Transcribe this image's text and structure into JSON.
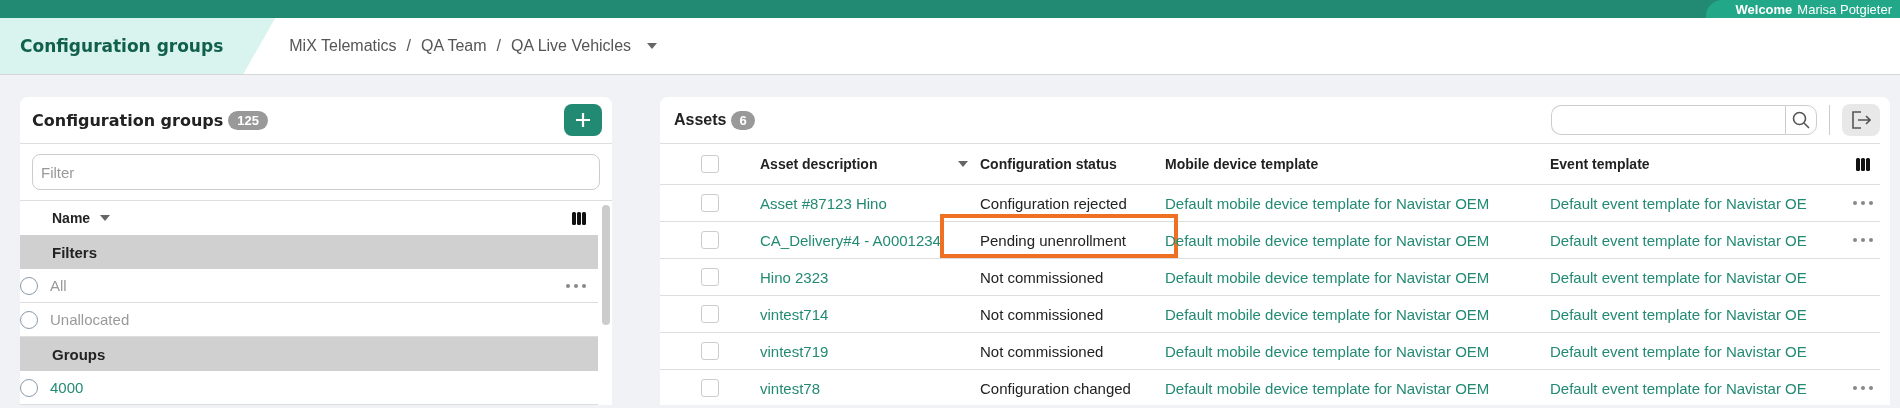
{
  "top_bar": {
    "welcome_label": "Welcome",
    "user_name": "Marisa Potgieter"
  },
  "page_title": "Configuration groups",
  "breadcrumb": {
    "separator": "/",
    "items": [
      "MiX Telematics",
      "QA Team",
      "QA Live Vehicles"
    ]
  },
  "groups_panel": {
    "title": "Configuration groups",
    "count": "125",
    "filter": {
      "placeholder": "Filter"
    },
    "column": {
      "label": "Name",
      "sorted": true
    },
    "sections": [
      {
        "title": "Filters",
        "items": [
          {
            "label": "All",
            "kind": "filter",
            "selected": false,
            "has_menu": true
          },
          {
            "label": "Unallocated",
            "kind": "filter",
            "selected": false,
            "has_menu": false
          }
        ]
      },
      {
        "title": "Groups",
        "items": [
          {
            "label": "4000",
            "kind": "group",
            "selected": false,
            "has_menu": false
          }
        ]
      }
    ]
  },
  "assets_panel": {
    "title": "Assets",
    "count": "6",
    "select_all": {
      "checked": false
    },
    "columns": [
      {
        "label": "Asset description",
        "sorted": true
      },
      {
        "label": "Configuration status",
        "sorted": false
      },
      {
        "label": "Mobile device template",
        "sorted": false
      },
      {
        "label": "Event template",
        "sorted": false
      }
    ],
    "rows": [
      {
        "checked": false,
        "highlighted": false,
        "has_menu": true,
        "cells": [
          "Asset #87123 Hino",
          "Configuration rejected",
          "Default mobile device template for Navistar OEM",
          "Default event template for Navistar OE"
        ]
      },
      {
        "checked": false,
        "highlighted": true,
        "has_menu": true,
        "cells": [
          "CA_Delivery#4 - A0001234",
          "Pending unenrollment",
          "Default mobile device template for Navistar OEM",
          "Default event template for Navistar OE"
        ]
      },
      {
        "checked": false,
        "highlighted": false,
        "has_menu": false,
        "cells": [
          "Hino 2323",
          "Not commissioned",
          "Default mobile device template for Navistar OEM",
          "Default event template for Navistar OE"
        ]
      },
      {
        "checked": false,
        "highlighted": false,
        "has_menu": false,
        "cells": [
          "vintest714",
          "Not commissioned",
          "Default mobile device template for Navistar OEM",
          "Default event template for Navistar OE"
        ]
      },
      {
        "checked": false,
        "highlighted": false,
        "has_menu": false,
        "cells": [
          "vintest719",
          "Not commissioned",
          "Default mobile device template for Navistar OEM",
          "Default event template for Navistar OE"
        ]
      },
      {
        "checked": false,
        "highlighted": false,
        "has_menu": true,
        "cells": [
          "vintest78",
          "Configuration changed",
          "Default mobile device template for Navistar OEM",
          "Default event template for Navistar OE"
        ]
      }
    ]
  }
}
